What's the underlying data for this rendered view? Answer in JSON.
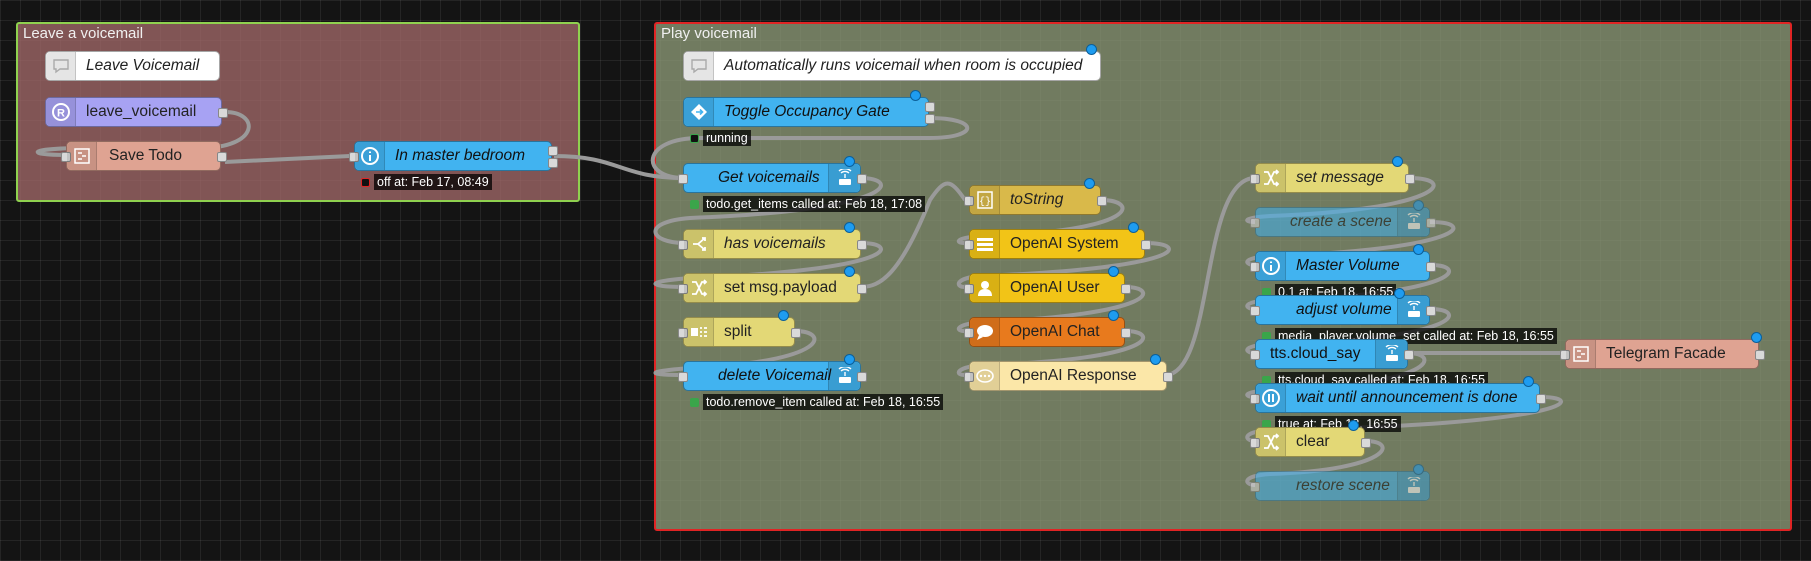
{
  "groups": {
    "leave": {
      "label": "Leave a voicemail"
    },
    "play": {
      "label": "Play voicemail"
    }
  },
  "colors": {
    "group_leave_bg": "#8a5d5d",
    "group_leave_border": "#8fd14f",
    "group_play_bg": "#7d8a6a",
    "group_play_border": "#e02424",
    "comment": "#ffffff",
    "ha_blue": "#41b3f0",
    "function_yellow": "#e3d876",
    "template_gold": "#d9b94a",
    "openai_yellow": "#f2c417",
    "openai_orange": "#e87a1d",
    "openai_cream": "#fbe7a8",
    "todo_salmon": "#dfa392",
    "purple": "#a7a2f3",
    "status_green": "#3aa54a",
    "status_red": "#e02424"
  },
  "nodes": {
    "leave_voicemail_comment": {
      "label": "Leave Voicemail",
      "icon": "comment-icon"
    },
    "leave_voicemail": {
      "label": "leave_voicemail",
      "icon": "registered-icon"
    },
    "save_todo": {
      "label": "Save Todo",
      "icon": "subflow-icon"
    },
    "in_master_bedroom": {
      "label": "In master bedroom",
      "icon": "info-icon",
      "status": "off at: Feb 17, 08:49"
    },
    "auto_comment": {
      "label": "Automatically runs voicemail when room is occupied",
      "icon": "comment-icon"
    },
    "toggle_occupancy": {
      "label": "Toggle Occupancy Gate",
      "icon": "gate-icon",
      "status": "running"
    },
    "get_voicemails": {
      "label": "Get voicemails",
      "icon": "service-icon",
      "status": "todo.get_items called at: Feb 18, 17:08"
    },
    "has_voicemails": {
      "label": "has voicemails",
      "icon": "switch-icon"
    },
    "set_msg_payload": {
      "label": "set msg.payload",
      "icon": "change-icon"
    },
    "split": {
      "label": "split",
      "icon": "split-icon"
    },
    "delete_voicemail": {
      "label": "delete Voicemail",
      "icon": "service-icon",
      "status": "todo.remove_item called at: Feb 18, 16:55"
    },
    "to_string": {
      "label": "toString",
      "icon": "template-icon"
    },
    "openai_system": {
      "label": "OpenAI System",
      "icon": "list-icon"
    },
    "openai_user": {
      "label": "OpenAI User",
      "icon": "user-icon"
    },
    "openai_chat": {
      "label": "OpenAI Chat",
      "icon": "chat-icon"
    },
    "openai_response": {
      "label": "OpenAI Response",
      "icon": "ellipsis-icon"
    },
    "set_message": {
      "label": "set message",
      "icon": "change-icon"
    },
    "create_scene": {
      "label": "create a scene",
      "icon": "service-icon"
    },
    "master_volume": {
      "label": "Master Volume",
      "icon": "info-icon",
      "status": "0.1 at: Feb 18, 16:55"
    },
    "adjust_volume": {
      "label": "adjust volume",
      "icon": "service-icon",
      "status": "media_player.volume_set called at: Feb 18, 16:55"
    },
    "tts_cloud_say": {
      "label": "tts.cloud_say",
      "icon": "service-icon",
      "status": "tts.cloud_say called at: Feb 18, 16:55"
    },
    "telegram_facade": {
      "label": "Telegram Facade",
      "icon": "subflow-icon"
    },
    "wait_announcement": {
      "label": "wait until announcement is done",
      "icon": "pause-icon",
      "status": "true at: Feb 18, 16:55"
    },
    "clear": {
      "label": "clear",
      "icon": "change-icon"
    },
    "restore_scene": {
      "label": "restore scene",
      "icon": "service-icon"
    }
  }
}
